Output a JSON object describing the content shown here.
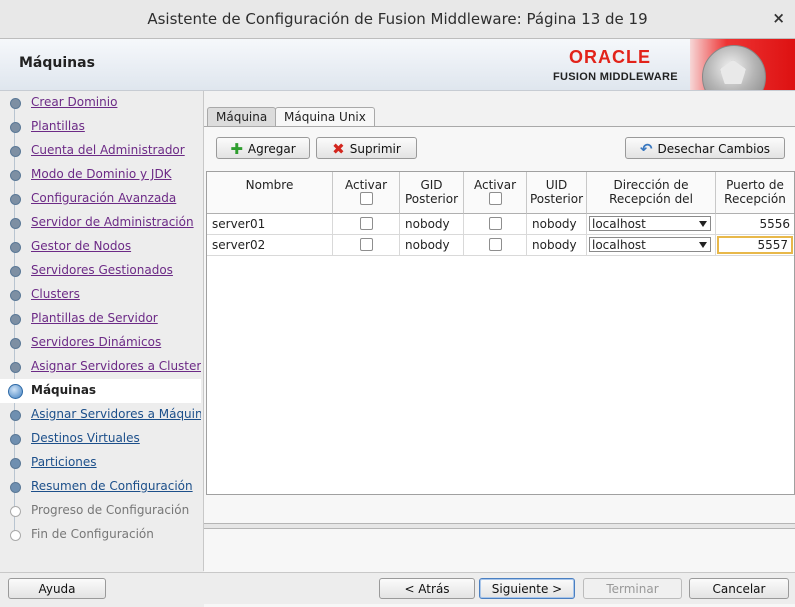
{
  "window": {
    "title": "Asistente de Configuración de Fusion Middleware: Página 13 de 19",
    "close_label": "×"
  },
  "header": {
    "page_title": "Máquinas",
    "brand": "ORACLE",
    "product": "FUSION MIDDLEWARE"
  },
  "nav": {
    "items": [
      {
        "label": "Crear Dominio",
        "state": "visited"
      },
      {
        "label": "Plantillas",
        "state": "visited"
      },
      {
        "label": "Cuenta del Administrador",
        "state": "visited"
      },
      {
        "label": "Modo de Dominio y JDK",
        "state": "visited"
      },
      {
        "label": "Configuración Avanzada",
        "state": "visited"
      },
      {
        "label": "Servidor de Administración",
        "state": "visited"
      },
      {
        "label": "Gestor de Nodos",
        "state": "visited"
      },
      {
        "label": "Servidores Gestionados",
        "state": "visited"
      },
      {
        "label": "Clusters",
        "state": "visited"
      },
      {
        "label": "Plantillas de Servidor",
        "state": "visited"
      },
      {
        "label": "Servidores Dinámicos",
        "state": "visited"
      },
      {
        "label": "Asignar Servidores a Clusters",
        "state": "visited"
      },
      {
        "label": "Máquinas",
        "state": "current"
      },
      {
        "label": "Asignar Servidores a Máquinas",
        "state": "link"
      },
      {
        "label": "Destinos Virtuales",
        "state": "link"
      },
      {
        "label": "Particiones",
        "state": "link"
      },
      {
        "label": "Resumen de Configuración",
        "state": "link"
      },
      {
        "label": "Progreso de Configuración",
        "state": "disabled"
      },
      {
        "label": "Fin de Configuración",
        "state": "disabled"
      }
    ]
  },
  "tabs": [
    {
      "label": "Máquina",
      "active": false
    },
    {
      "label": "Máquina Unix",
      "active": true
    }
  ],
  "toolbar": {
    "add_label": "Agregar",
    "delete_label": "Suprimir",
    "discard_label": "Desechar Cambios"
  },
  "table": {
    "headers": {
      "nombre": "Nombre",
      "activar1": "Activar",
      "gid_l1": "GID",
      "gid_l2": "Posterior",
      "activar2": "Activar",
      "uid_l1": "UID",
      "uid_l2": "Posterior",
      "dir_l1": "Dirección de",
      "dir_l2": "Recepción del",
      "puerto_l1": "Puerto de",
      "puerto_l2": "Recepción"
    },
    "rows": [
      {
        "nombre": "server01",
        "gid": "nobody",
        "uid": "nobody",
        "direccion": "localhost",
        "puerto": "5556"
      },
      {
        "nombre": "server02",
        "gid": "nobody",
        "uid": "nobody",
        "direccion": "localhost",
        "puerto": "5557"
      }
    ]
  },
  "footer": {
    "help_label": "Ayuda",
    "back_label": "< Atrás",
    "next_label": "Siguiente >",
    "finish_label": "Terminar",
    "cancel_label": "Cancelar"
  }
}
